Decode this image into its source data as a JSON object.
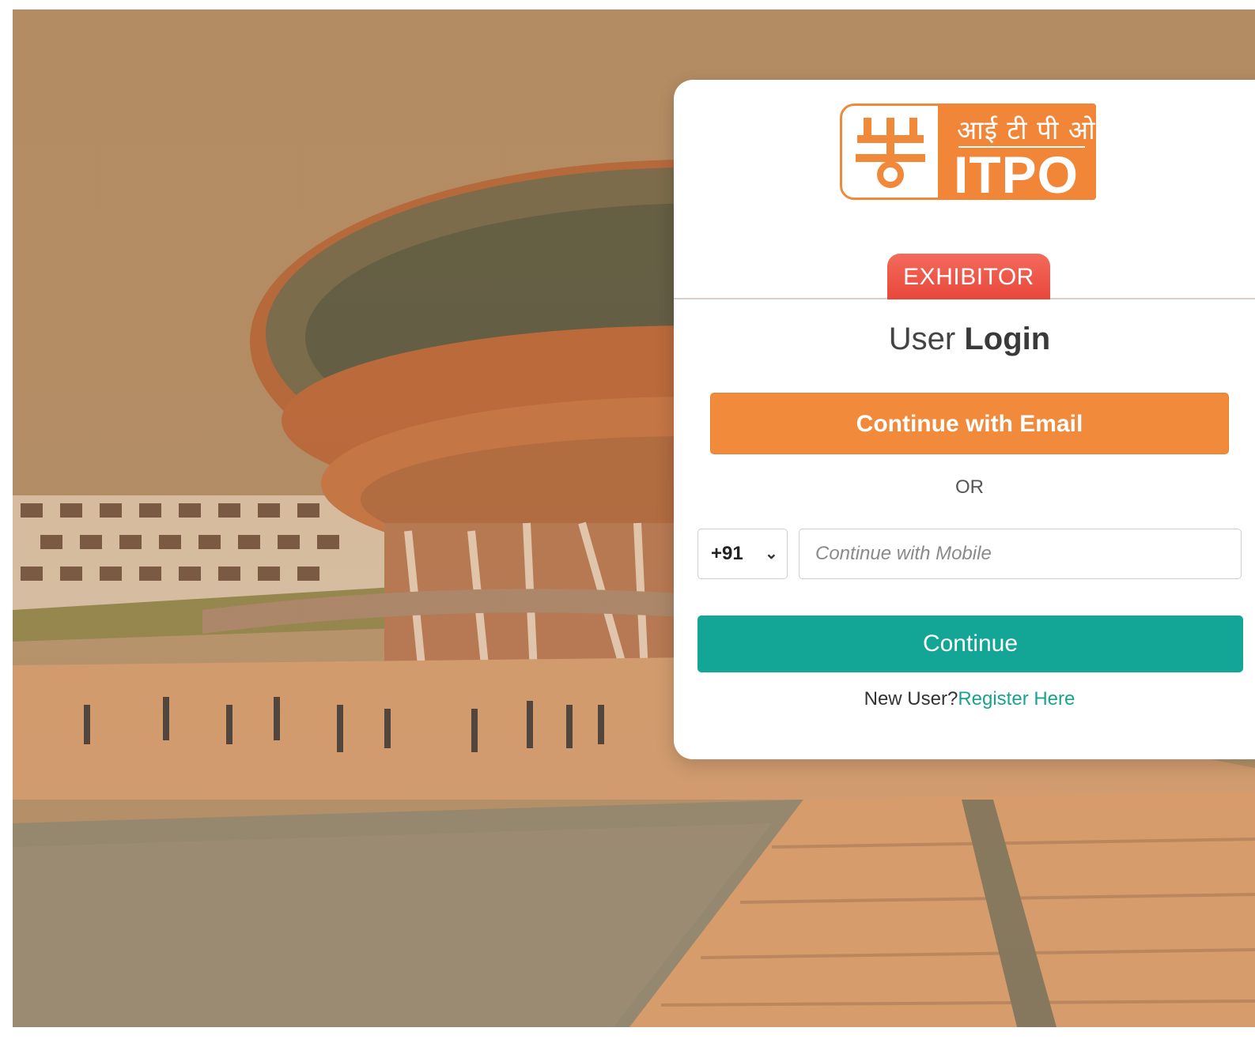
{
  "logo": {
    "hindi_text": "आई टी पी ओ",
    "text": "ITPO"
  },
  "tab": {
    "label": "EXHIBITOR"
  },
  "title": {
    "prefix": "User ",
    "bold": "Login"
  },
  "email_button": {
    "label": "Continue with Email"
  },
  "divider": {
    "label": "OR"
  },
  "country_code": {
    "value": "+91"
  },
  "mobile_input": {
    "placeholder": "Continue with Mobile"
  },
  "continue_button": {
    "label": "Continue"
  },
  "register": {
    "prompt": "New User?",
    "link": "Register Here"
  },
  "colors": {
    "accent_orange": "#f28a3c",
    "tab_red": "#e8473a",
    "teal": "#13a595"
  }
}
